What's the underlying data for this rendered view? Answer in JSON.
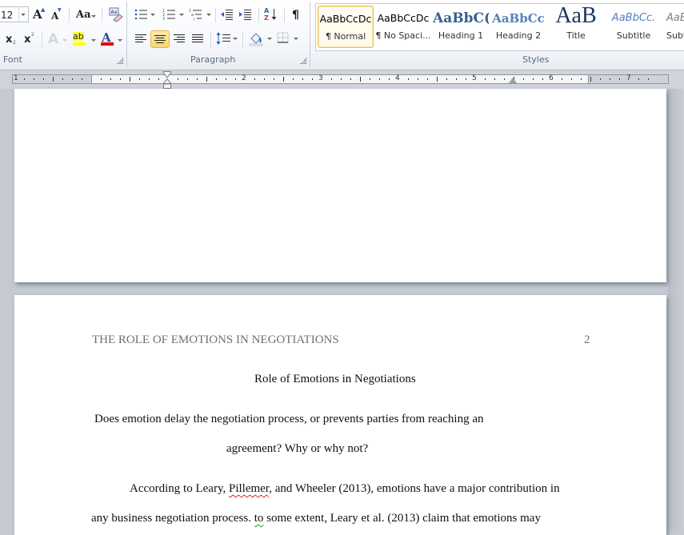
{
  "ribbon": {
    "font_group": {
      "label": "Font",
      "font_size": "12",
      "grow_font": "A",
      "shrink_font": "A",
      "change_case": "Aa",
      "subscript": "x",
      "subscript_mark": "2",
      "superscript": "x",
      "superscript_mark": "2",
      "text_effects": "A",
      "highlight": "ab",
      "font_color": "A",
      "highlight_color": "#ffff00",
      "font_color_value": "#e00000"
    },
    "paragraph_group": {
      "label": "Paragraph",
      "sort_icon_text": "A Z",
      "show_marks": "¶",
      "active_alignment": "center"
    },
    "styles_group": {
      "label": "Styles",
      "items": [
        {
          "preview": "AaBbCcDc",
          "name": "¶ Normal",
          "selected": true
        },
        {
          "preview": "AaBbCcDc",
          "name": "¶ No Spaci...",
          "selected": false
        },
        {
          "preview": "AaBbC(",
          "name": "Heading 1",
          "selected": false
        },
        {
          "preview": "AaBbCc",
          "name": "Heading 2",
          "selected": false
        },
        {
          "preview": "AaB",
          "name": "Title",
          "selected": false
        },
        {
          "preview": "AaBbCc.",
          "name": "Subtitle",
          "selected": false
        },
        {
          "preview": "AaB",
          "name": "Subt",
          "selected": false
        }
      ]
    }
  },
  "ruler": {
    "numbers": [
      "1",
      "1",
      "2",
      "3",
      "4",
      "5",
      "6",
      "7"
    ]
  },
  "document": {
    "page2": {
      "running_head": "THE ROLE OF EMOTIONS IN NEGOTIATIONS",
      "page_number": "2",
      "title": "Role of Emotions in Negotiations",
      "question_line1": "Does emotion delay the negotiation process, or prevents parties from reaching an",
      "question_line2": "agreement? Why or why not?",
      "para1_line1_a": "According to Leary, ",
      "para1_line1_spell": "Pillemer",
      "para1_line1_b": ",  and Wheeler (2013), emotions have a major contribution in",
      "para1_line2_a": "any business negotiation process. ",
      "para1_line2_gram": "to",
      "para1_line2_b": " some extent, Leary et al. (2013) claim that emotions may"
    }
  }
}
